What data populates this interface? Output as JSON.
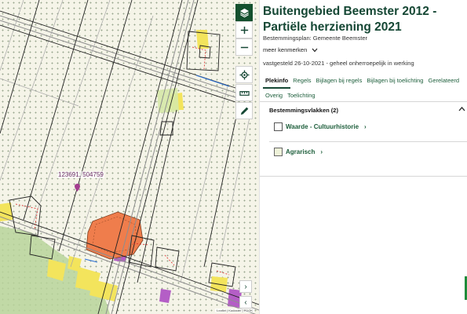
{
  "map": {
    "coord_label": "123691, 504759",
    "attribution": "Leaflet | Kadaster | PDOK"
  },
  "controls": [
    {
      "name": "layers-button",
      "icon": "layers-icon",
      "dark": true
    },
    {
      "name": "zoom-in-button",
      "icon": "plus-icon",
      "dark": false,
      "glyph": "+"
    },
    {
      "name": "zoom-out-button",
      "icon": "minus-icon",
      "dark": false,
      "glyph": "−"
    },
    {
      "name": "locate-button",
      "icon": "crosshair-icon",
      "dark": false
    },
    {
      "name": "measure-button",
      "icon": "ruler-icon",
      "dark": false
    },
    {
      "name": "draw-button",
      "icon": "pencil-icon",
      "dark": false
    }
  ],
  "panel": {
    "title": "Buitengebied Beemster 2012 - Partiële herziening 2021",
    "plan_type_label": "Bestemmingsplan",
    "plan_type_value": "Gemeente Beemster",
    "meer_label": "meer kenmerken",
    "status": "vastgesteld 26-10-2021 - geheel onherroepelijk in werking",
    "tabs_row1": [
      "Plekinfo",
      "Regels",
      "Bijlagen bij regels",
      "Bijlagen bij toelichting",
      "Gerelateerd"
    ],
    "tabs_row2": [
      "Overig",
      "Toelichting"
    ],
    "active_tab": "Plekinfo",
    "section_title": "Bestemmingsvlakken (2)",
    "items": [
      {
        "label": "Waarde - Cultuurhistorie",
        "arrow": "›",
        "color": "#ffffff"
      },
      {
        "label": "Agrarisch",
        "arrow": "›",
        "color": "#eef2d9"
      }
    ]
  },
  "colors": {
    "brand": "#154734",
    "map_background": "#f5f4e8",
    "orange_area": "#ef7d4c",
    "yellow_area": "#f3e45c",
    "purple_area": "#b45ec6",
    "green_area": "#b7d49a"
  }
}
